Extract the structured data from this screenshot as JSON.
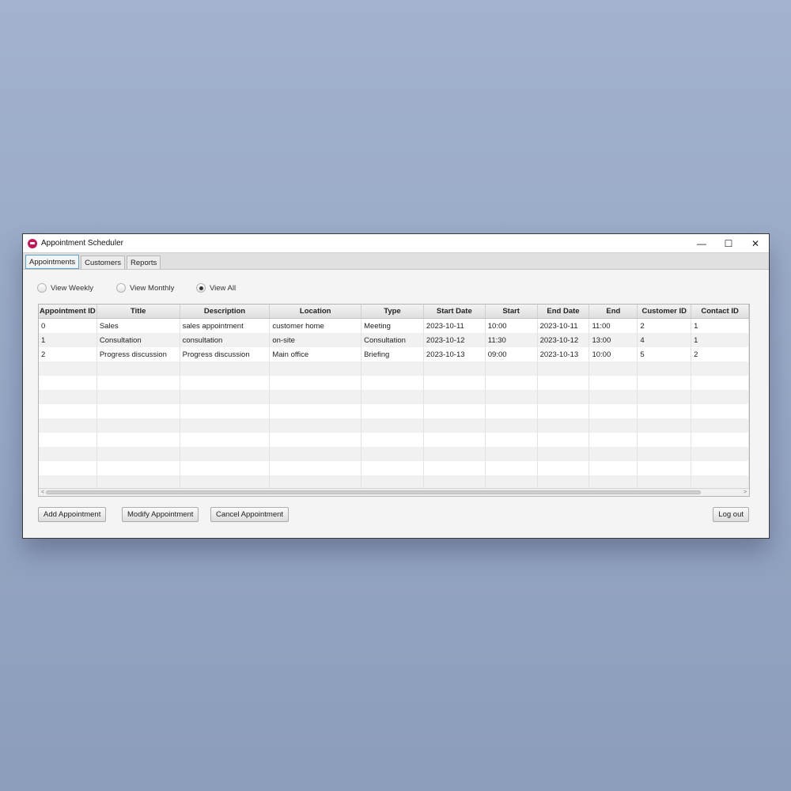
{
  "window": {
    "title": "Appointment Scheduler"
  },
  "window_controls": {
    "minimize": "—",
    "maximize": "☐",
    "close": "✕"
  },
  "tabs": [
    {
      "label": "Appointments",
      "active": true
    },
    {
      "label": "Customers",
      "active": false
    },
    {
      "label": "Reports",
      "active": false
    }
  ],
  "view_options": [
    {
      "label": "View Weekly",
      "selected": false
    },
    {
      "label": "View Monthly",
      "selected": false
    },
    {
      "label": "View All",
      "selected": true
    }
  ],
  "table": {
    "columns": [
      "Appointment ID",
      "Title",
      "Description",
      "Location",
      "Type",
      "Start Date",
      "Start",
      "End Date",
      "End",
      "Customer ID",
      "Contact ID"
    ],
    "rows": [
      [
        "0",
        "Sales",
        "sales appointment",
        "customer home",
        "Meeting",
        "2023-10-11",
        "10:00",
        "2023-10-11",
        "11:00",
        "2",
        "1"
      ],
      [
        "1",
        "Consultation",
        "consultation",
        "on-site",
        "Consultation",
        "2023-10-12",
        "11:30",
        "2023-10-12",
        "13:00",
        "4",
        "1"
      ],
      [
        "2",
        "Progress discussion",
        "Progress discussion",
        "Main office",
        "Briefing",
        "2023-10-13",
        "09:00",
        "2023-10-13",
        "10:00",
        "5",
        "2"
      ]
    ]
  },
  "scrollbar": {
    "left_arrow": "<",
    "right_arrow": ">"
  },
  "buttons": {
    "add": "Add Appointment",
    "modify": "Modify Appointment",
    "cancel": "Cancel Appointment",
    "logout": "Log out"
  },
  "colors": {
    "app_icon": "#c2185b",
    "active_tab_border": "#58a6d8"
  }
}
